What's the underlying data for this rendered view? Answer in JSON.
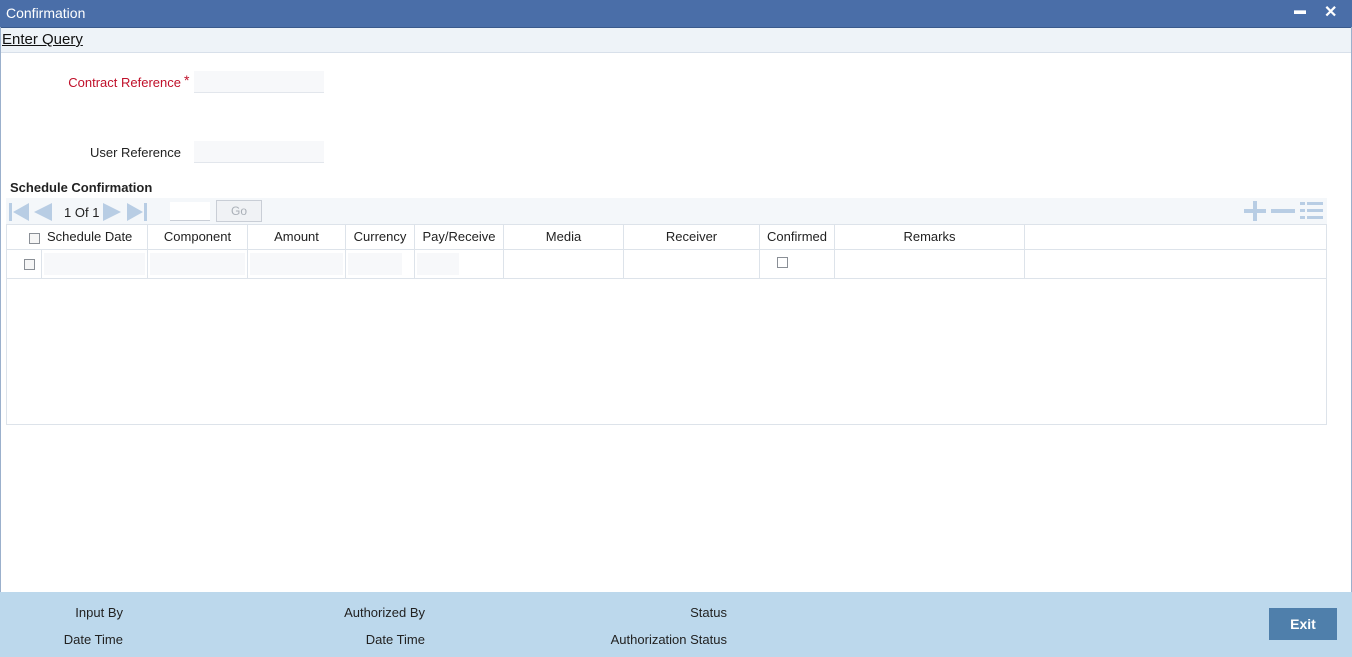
{
  "window": {
    "title": "Confirmation",
    "minimize_label": "▬",
    "close_label": "✕"
  },
  "toolbar": {
    "enter_query": "Enter Query"
  },
  "form": {
    "contract_reference": {
      "label": "Contract Reference",
      "required_mark": "*",
      "value": ""
    },
    "user_reference": {
      "label": "User Reference",
      "value": ""
    }
  },
  "schedule": {
    "title": "Schedule Confirmation",
    "pager": {
      "current": "1",
      "of_label": "Of",
      "total": "1",
      "page_input": ""
    },
    "go_label": "Go",
    "columns": [
      "Schedule Date",
      "Component",
      "Amount",
      "Currency",
      "Pay/Receive",
      "Media",
      "Receiver",
      "Confirmed",
      "Remarks"
    ],
    "rows": [
      {
        "schedule_date": "",
        "component": "",
        "amount": "",
        "currency": "",
        "pay_receive": "",
        "media": "",
        "receiver": "",
        "confirmed": false,
        "remarks": ""
      }
    ]
  },
  "footer": {
    "input_by": "Input By",
    "date_time_1": "Date Time",
    "authorized_by": "Authorized By",
    "date_time_2": "Date Time",
    "status": "Status",
    "authorization_status": "Authorization Status",
    "exit_label": "Exit"
  },
  "colors": {
    "title_bar": "#4a6ea8",
    "required": "#c0102a",
    "footer": "#bcd8ec",
    "exit_button": "#4f7fab"
  }
}
